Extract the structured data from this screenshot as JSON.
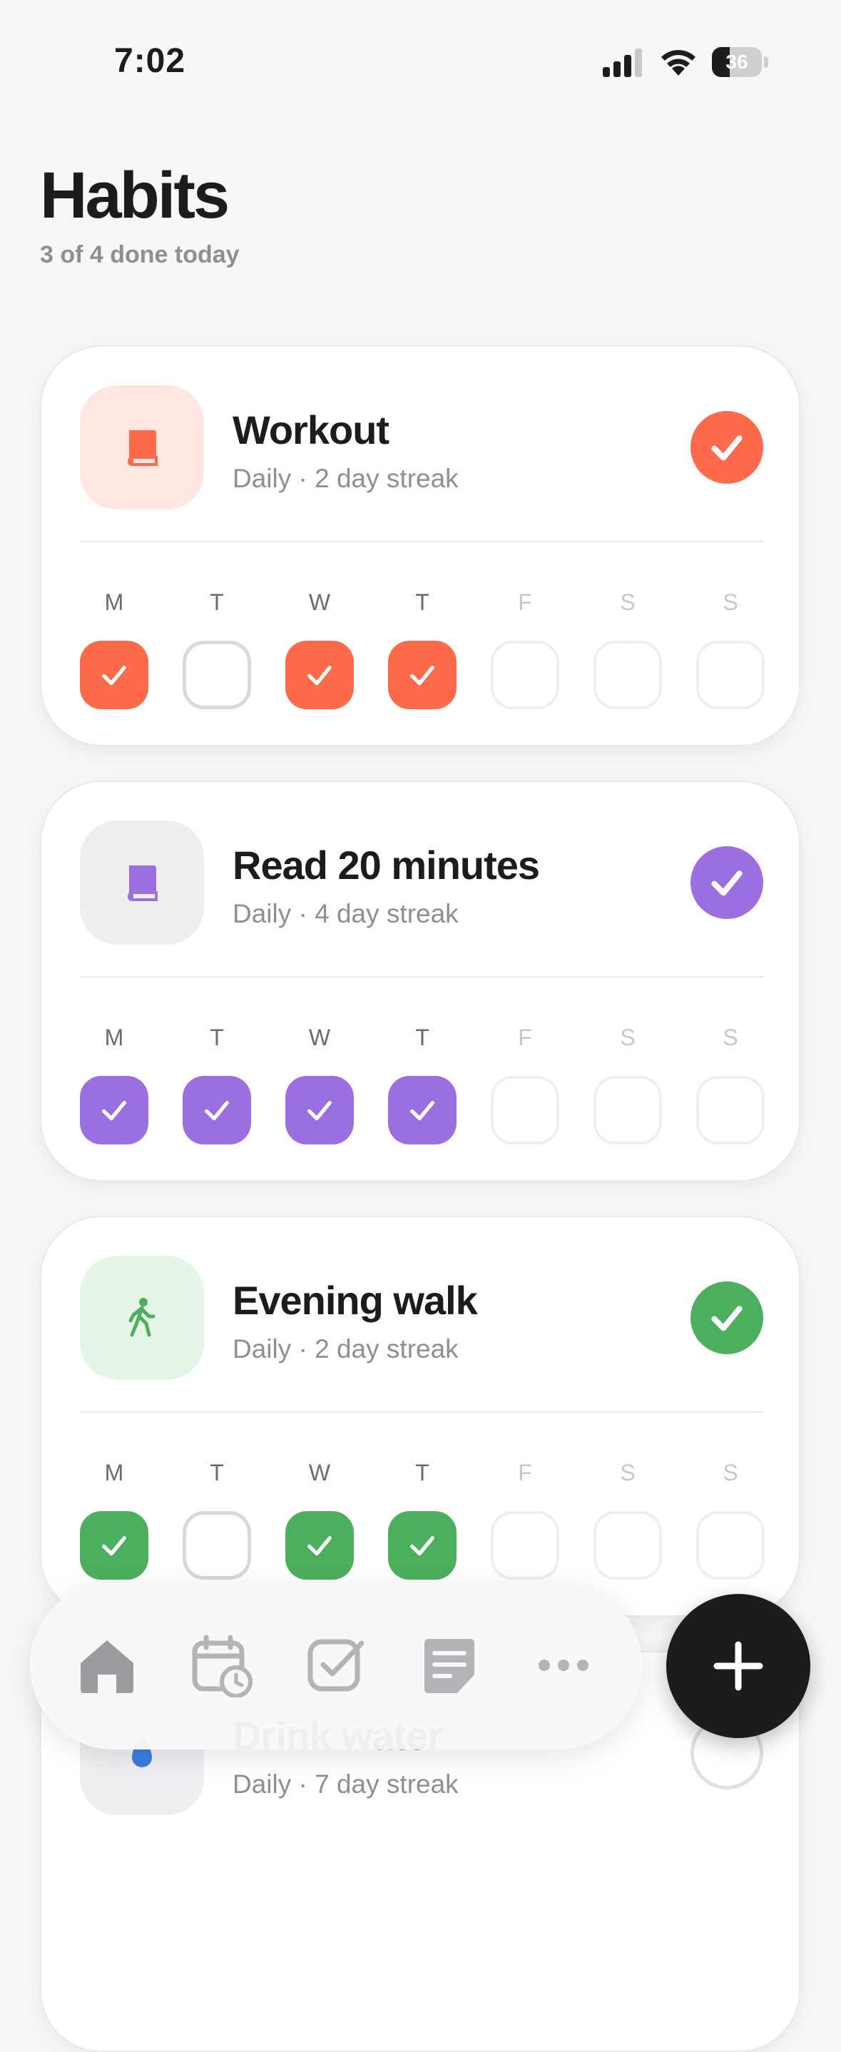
{
  "status_bar": {
    "time": "7:02",
    "battery": "36",
    "battery_level": 0.36
  },
  "header": {
    "title": "Habits",
    "subtitle": "3 of 4 done today"
  },
  "day_labels": [
    "M",
    "T",
    "W",
    "T",
    "F",
    "S",
    "S"
  ],
  "habits": [
    {
      "name": "Workout",
      "meta": "Daily · 2 day streak",
      "icon": "book-icon",
      "color": "#ff6b4a",
      "tile_color": "#ffe6e1",
      "done_today": true,
      "week": [
        "done",
        "missed",
        "done",
        "done",
        "future",
        "future",
        "future"
      ]
    },
    {
      "name": "Read 20 minutes",
      "meta": "Daily · 4 day streak",
      "icon": "book-icon",
      "color": "#9b6fe0",
      "tile_color": "#efeff2",
      "done_today": true,
      "week": [
        "done",
        "done",
        "done",
        "done",
        "future",
        "future",
        "future"
      ]
    },
    {
      "name": "Evening walk",
      "meta": "Daily · 2 day streak",
      "icon": "walking-icon",
      "color": "#4caf5f",
      "tile_color": "#e6f5e8",
      "done_today": true,
      "week": [
        "done",
        "missed",
        "done",
        "done",
        "future",
        "future",
        "future"
      ]
    },
    {
      "name": "Drink water",
      "meta": "Daily · 7 day streak",
      "icon": "water-drop-icon",
      "color": "#3b7de0",
      "tile_color": "#efeff2",
      "done_today": false,
      "week": []
    }
  ],
  "tab_bar": {
    "tabs": [
      "home-icon",
      "calendar-clock-icon",
      "checkbox-icon",
      "notes-icon",
      "more-icon"
    ],
    "active": "home-icon"
  },
  "fab": {
    "icon": "plus-icon"
  }
}
